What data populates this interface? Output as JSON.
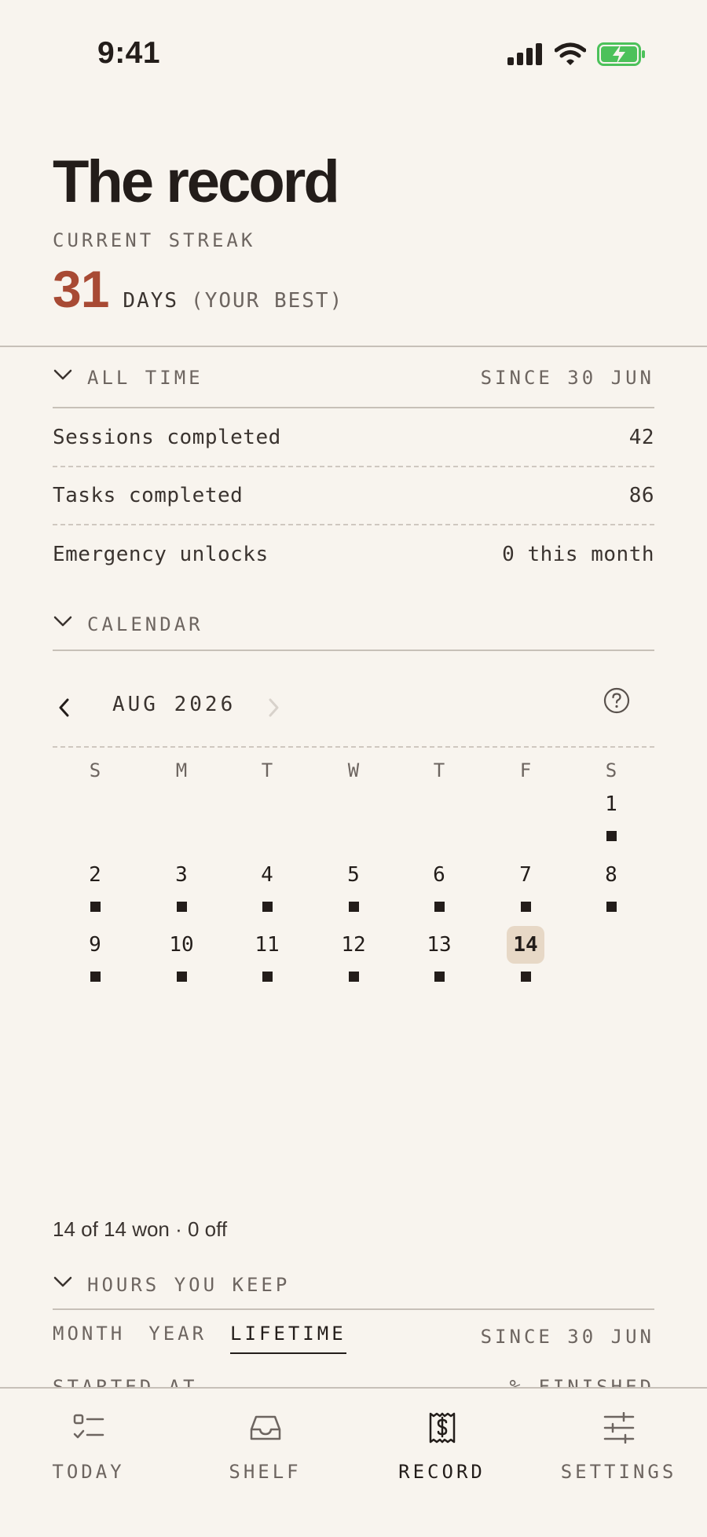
{
  "status_bar": {
    "time": "9:41"
  },
  "header": {
    "title": "The record",
    "streak_label": "CURRENT STREAK",
    "streak_value": "31",
    "streak_unit": "DAYS",
    "streak_note": "(YOUR BEST)"
  },
  "all_time": {
    "title": "ALL TIME",
    "since": "SINCE 30 JUN",
    "rows": [
      {
        "label": "Sessions completed",
        "value": "42"
      },
      {
        "label": "Tasks completed",
        "value": "86"
      },
      {
        "label": "Emergency unlocks",
        "value": "0 this month"
      }
    ]
  },
  "calendar": {
    "title": "CALENDAR",
    "month": "AUG 2026",
    "weekdays": [
      "S",
      "M",
      "T",
      "W",
      "T",
      "F",
      "S"
    ],
    "days": [
      "1",
      "2",
      "3",
      "4",
      "5",
      "6",
      "7",
      "8",
      "9",
      "10",
      "11",
      "12",
      "13",
      "14"
    ],
    "today": "14",
    "summary": "14 of 14 won · 0 off"
  },
  "hours": {
    "title": "HOURS YOU KEEP",
    "tabs": [
      "MONTH",
      "YEAR",
      "LIFETIME"
    ],
    "active_tab": "LIFETIME",
    "since": "SINCE 30 JUN",
    "col_left": "STARTED AT",
    "col_right": "% FINISHED"
  },
  "tabbar": {
    "items": [
      {
        "label": "TODAY",
        "icon": "checklist-icon"
      },
      {
        "label": "SHELF",
        "icon": "inbox-tray-icon"
      },
      {
        "label": "RECORD",
        "icon": "receipt-dollar-icon"
      },
      {
        "label": "SETTINGS",
        "icon": "sliders-icon"
      }
    ],
    "active": "RECORD"
  },
  "colors": {
    "background": "#f8f4ee",
    "text": "#231d1a",
    "muted": "#6d6560",
    "accent": "#a84a34",
    "today_highlight": "#e7d8c6",
    "battery": "#4cc15a"
  }
}
